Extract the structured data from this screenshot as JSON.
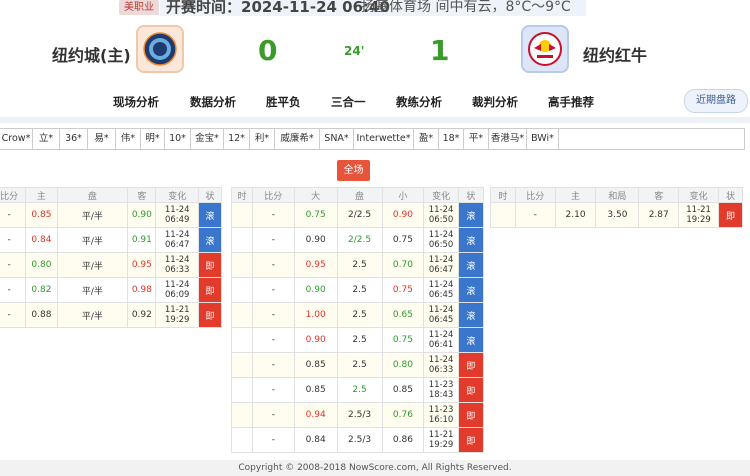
{
  "header": {
    "league": "美职业",
    "kickoff": "开赛时间：2024-11-24 06:40",
    "venue": "扬基体育场  间中有云，8°C～9°C",
    "home_name": "纽约城(主)",
    "away_name": "纽约红牛",
    "home_score": "0",
    "away_score": "1",
    "minute": "24'"
  },
  "nav": {
    "items": [
      "现场分析",
      "数据分析",
      "胜平负",
      "三合一",
      "教练分析",
      "裁判分析",
      "高手推荐"
    ],
    "recent": "近期盘路"
  },
  "companies": [
    "Crow*",
    "立*",
    "36*",
    "易*",
    "伟*",
    "明*",
    "10*",
    "金宝*",
    "12*",
    "利*",
    "威廉希*",
    "SNA*",
    "Interwette*",
    "盈*",
    "18*",
    "平*",
    "香港马*",
    "BWi*"
  ],
  "fulltime_label": "全场",
  "handicap_table": {
    "headers": [
      "比分",
      "主",
      "盘",
      "客",
      "变化",
      "状"
    ],
    "rows": [
      {
        "score": "-",
        "home": "0.85",
        "line": "平/半",
        "away": "0.90",
        "d": "11-24",
        "t": "06:49",
        "status": "滚",
        "hc": "red",
        "ac": "green",
        "sc": "blue"
      },
      {
        "score": "-",
        "home": "0.84",
        "line": "平/半",
        "away": "0.91",
        "d": "11-24",
        "t": "06:47",
        "status": "滚",
        "hc": "red",
        "ac": "green",
        "sc": "blue"
      },
      {
        "score": "-",
        "home": "0.80",
        "line": "平/半",
        "away": "0.95",
        "d": "11-24",
        "t": "06:33",
        "status": "即",
        "hc": "green",
        "ac": "red",
        "sc": "redbg"
      },
      {
        "score": "-",
        "home": "0.82",
        "line": "平/半",
        "away": "0.98",
        "d": "11-24",
        "t": "06:09",
        "status": "即",
        "hc": "green",
        "ac": "red",
        "sc": "redbg"
      },
      {
        "score": "-",
        "home": "0.88",
        "line": "平/半",
        "away": "0.92",
        "d": "11-21",
        "t": "19:29",
        "status": "即",
        "hc": "",
        "ac": "",
        "sc": "redbg"
      }
    ]
  },
  "overunder_table": {
    "headers": [
      "时",
      "比分",
      "大",
      "盘",
      "小",
      "变化",
      "状"
    ],
    "rows": [
      {
        "time": "",
        "score": "-",
        "over": "0.75",
        "line": "2/2.5",
        "under": "0.90",
        "d": "11-24",
        "t": "06:50",
        "status": "滚",
        "oc": "green",
        "lc": "",
        "uc": "red",
        "sc": "blue"
      },
      {
        "time": "",
        "score": "-",
        "over": "0.90",
        "line": "2/2.5",
        "under": "0.75",
        "d": "11-24",
        "t": "06:50",
        "status": "滚",
        "oc": "",
        "lc": "green",
        "uc": "",
        "sc": "blue"
      },
      {
        "time": "",
        "score": "-",
        "over": "0.95",
        "line": "2.5",
        "under": "0.70",
        "d": "11-24",
        "t": "06:47",
        "status": "滚",
        "oc": "red",
        "lc": "",
        "uc": "green",
        "sc": "blue"
      },
      {
        "time": "",
        "score": "-",
        "over": "0.90",
        "line": "2.5",
        "under": "0.75",
        "d": "11-24",
        "t": "06:45",
        "status": "滚",
        "oc": "green",
        "lc": "",
        "uc": "red",
        "sc": "blue"
      },
      {
        "time": "",
        "score": "-",
        "over": "1.00",
        "line": "2.5",
        "under": "0.65",
        "d": "11-24",
        "t": "06:45",
        "status": "滚",
        "oc": "red",
        "lc": "",
        "uc": "green",
        "sc": "blue"
      },
      {
        "time": "",
        "score": "-",
        "over": "0.90",
        "line": "2.5",
        "under": "0.75",
        "d": "11-24",
        "t": "06:41",
        "status": "滚",
        "oc": "red",
        "lc": "",
        "uc": "green",
        "sc": "blue"
      },
      {
        "time": "",
        "score": "-",
        "over": "0.85",
        "line": "2.5",
        "under": "0.80",
        "d": "11-24",
        "t": "06:33",
        "status": "即",
        "oc": "",
        "lc": "",
        "uc": "green",
        "sc": "redbg"
      },
      {
        "time": "",
        "score": "-",
        "over": "0.85",
        "line": "2.5",
        "under": "0.85",
        "d": "11-23",
        "t": "18:43",
        "status": "即",
        "oc": "",
        "lc": "green",
        "uc": "",
        "sc": "redbg"
      },
      {
        "time": "",
        "score": "-",
        "over": "0.94",
        "line": "2.5/3",
        "under": "0.76",
        "d": "11-23",
        "t": "16:10",
        "status": "即",
        "oc": "red",
        "lc": "",
        "uc": "green",
        "sc": "redbg"
      },
      {
        "time": "",
        "score": "-",
        "over": "0.84",
        "line": "2.5/3",
        "under": "0.86",
        "d": "11-21",
        "t": "19:29",
        "status": "即",
        "oc": "",
        "lc": "",
        "uc": "",
        "sc": "redbg"
      }
    ]
  },
  "europe_table": {
    "headers": [
      "时",
      "比分",
      "主",
      "和局",
      "客",
      "变化",
      "状"
    ],
    "rows": [
      {
        "time": "",
        "score": "-",
        "home": "2.10",
        "draw": "3.50",
        "away": "2.87",
        "d": "11-21",
        "t": "19:29",
        "status": "即",
        "sc": "redbg"
      }
    ]
  },
  "footer": "Copyright © 2008-2018 NowScore.com, All Rights Reserved."
}
